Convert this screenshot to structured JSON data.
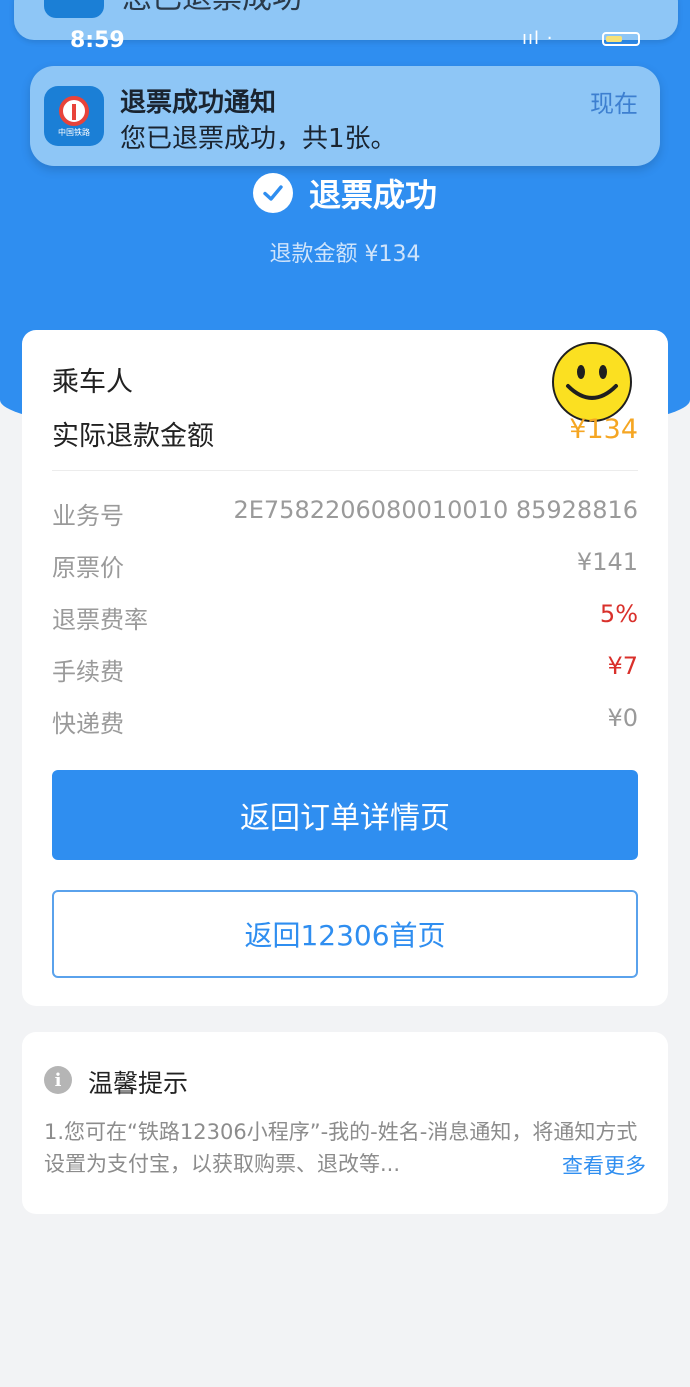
{
  "status_bar": {
    "time": "8:59",
    "signal": "ııl ·"
  },
  "notification_top": {
    "text": "您已退票成功"
  },
  "notification": {
    "app_icon_text": "中国铁路",
    "title": "退票成功通知",
    "body": "您已退票成功，共1张。",
    "time": "现在"
  },
  "header": {
    "success_label": "退票成功",
    "refund_amount_line": "退款金额 ¥134"
  },
  "card": {
    "passenger_label": "乘车人",
    "passenger_value": "",
    "actual_refund_label": "实际退款金额",
    "actual_refund_value": "¥134",
    "details": [
      {
        "key": "业务号",
        "value": "2E7582206080010010 85928816"
      },
      {
        "key": "原票价",
        "value": "¥141"
      },
      {
        "key": "退票费率",
        "value": "5%"
      },
      {
        "key": "手续费",
        "value": "¥7"
      },
      {
        "key": "快递费",
        "value": "¥0"
      }
    ],
    "primary_button": "返回订单详情页",
    "secondary_button": "返回12306首页"
  },
  "tips": {
    "title": "温馨提示",
    "body": "1.您可在“铁路12306小程序”-我的-姓名-消息通知，将通知方式设置为支付宝，以获取购票、退改等...",
    "more": "查看更多"
  },
  "colors": {
    "primary_blue": "#2f8ef0",
    "amount_orange": "#f5a623",
    "fee_red": "#d9302b"
  }
}
